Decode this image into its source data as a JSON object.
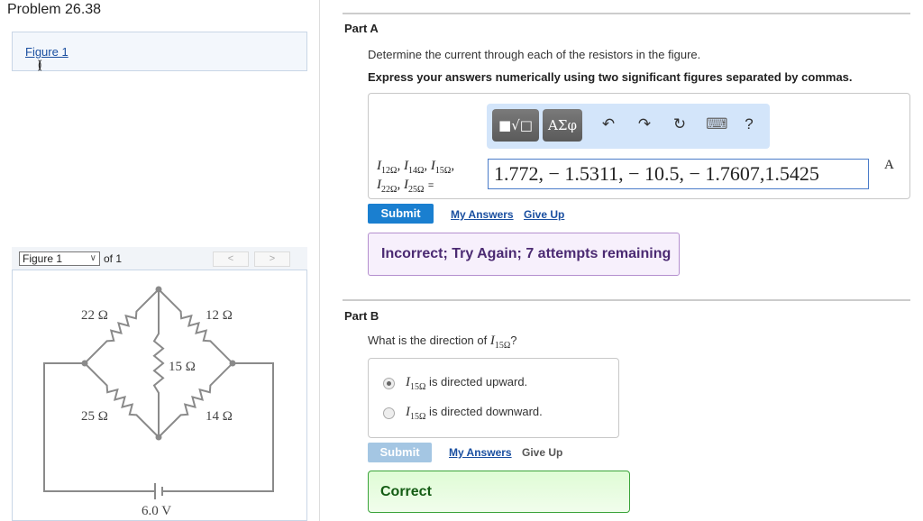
{
  "problem_title": "Problem 26.38",
  "figure_link": {
    "prefix": "(",
    "label": "Figure 1",
    "suffix": ")"
  },
  "figure_viewer": {
    "selected": "Figure 1",
    "of_label": "of 1",
    "prev": "<",
    "next": ">"
  },
  "circuit": {
    "labels": {
      "r22": "22 Ω",
      "r12": "12 Ω",
      "r15": "15 Ω",
      "r25": "25 Ω",
      "r14": "14 Ω",
      "battery": "6.0 V"
    },
    "wire_color": "#8a8a8a"
  },
  "partA": {
    "heading": "Part A",
    "question": "Determine the current through each of the resistors in the figure.",
    "instruction": "Express your answers numerically using two significant figures separated by commas.",
    "toolbar": {
      "template": "■√□",
      "greek": "ΑΣφ",
      "undo": "↶",
      "redo": "↷",
      "reset": "↻",
      "keyboard": "⌨",
      "help": "?"
    },
    "vars": [
      {
        "sym": "I",
        "sub": "12Ω"
      },
      {
        "sym": "I",
        "sub": "14Ω"
      },
      {
        "sym": "I",
        "sub": "15Ω"
      },
      {
        "sym": "I",
        "sub": "22Ω"
      },
      {
        "sym": "I",
        "sub": "25Ω"
      }
    ],
    "equals": "=",
    "answer": "1.772, − 1.5311, − 10.5, − 1.7607,1.5425",
    "unit": "A",
    "submit": "Submit",
    "my_answers": "My Answers",
    "give_up": "Give Up",
    "feedback": "Incorrect; Try Again; 7 attempts remaining"
  },
  "partB": {
    "heading": "Part B",
    "question_prefix": "What is the direction of ",
    "question_sym": "I",
    "question_sub": "15Ω",
    "question_suffix": "?",
    "options": [
      {
        "sym": "I",
        "sub": "15Ω",
        "text": " is directed upward.",
        "selected": true
      },
      {
        "sym": "I",
        "sub": "15Ω",
        "text": " is directed downward.",
        "selected": false
      }
    ],
    "submit": "Submit",
    "my_answers": "My Answers",
    "give_up": "Give Up",
    "feedback": "Correct"
  },
  "colors": {
    "submit_blue": "#1a7fd0",
    "submit_disabled": "#a4c6e3",
    "incorrect_border": "#b48fcf",
    "correct_border": "#3aa33a"
  }
}
